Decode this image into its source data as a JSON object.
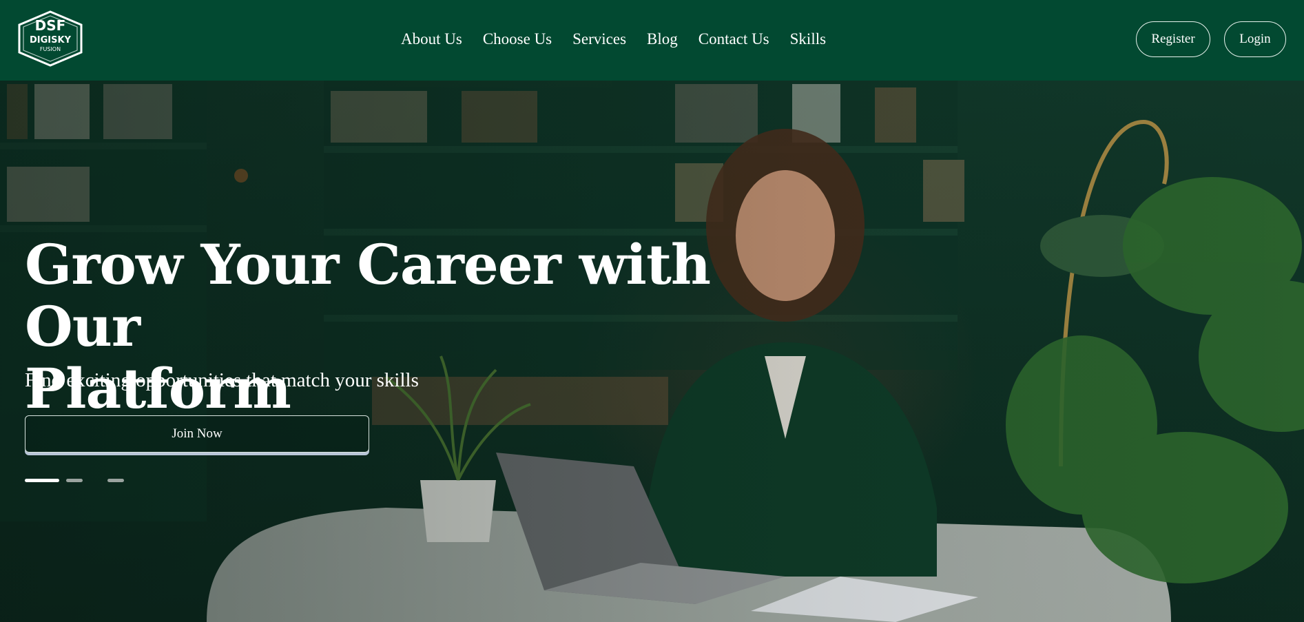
{
  "brand": {
    "logo_text_top": "DSF",
    "logo_text_mid": "DIGISKY",
    "logo_text_bottom": "FUSION",
    "logo_icon": "hexagon-logo"
  },
  "nav": {
    "items": [
      {
        "label": "About Us"
      },
      {
        "label": "Choose Us"
      },
      {
        "label": "Services"
      },
      {
        "label": "Blog"
      },
      {
        "label": "Contact Us"
      },
      {
        "label": "Skills"
      }
    ]
  },
  "auth": {
    "register_label": "Register",
    "login_label": "Login"
  },
  "hero": {
    "title_line1": "Grow Your Career with Our",
    "title_line2": "Platform",
    "subtitle": "Find exciting opportunities that match your skills",
    "cta_label": "Join Now",
    "carousel": {
      "slides": 3,
      "active_index": 0
    }
  },
  "colors": {
    "header_bg": "#024931",
    "text": "#ffffff",
    "accent_shadow": "#b9c6d8"
  }
}
